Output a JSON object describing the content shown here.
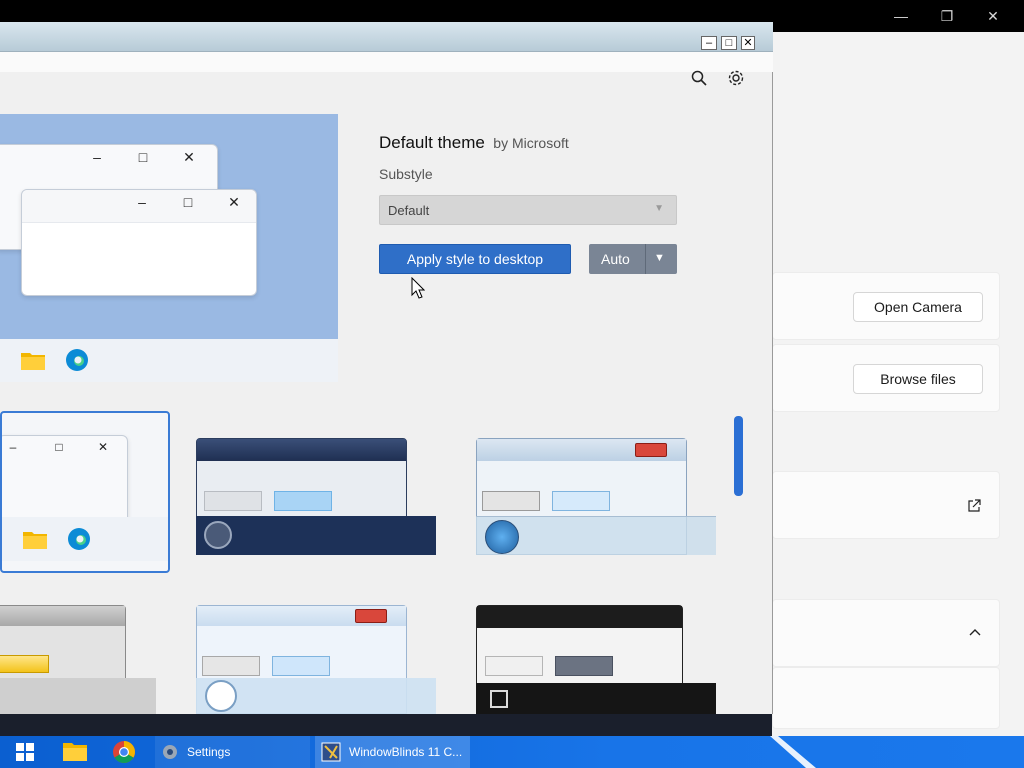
{
  "settings": {
    "open_camera": "Open Camera",
    "browse_files": "Browse files"
  },
  "theme": {
    "name": "Default theme",
    "author": "by Microsoft",
    "substyle_label": "Substyle",
    "substyle_value": "Default",
    "apply_label": "Apply style to desktop",
    "auto_label": "Auto"
  },
  "taskbar": {
    "settings_label": "Settings",
    "windowblinds_label": "WindowBlinds 11 C..."
  },
  "colors": {
    "accent": "#2f6fc8",
    "taskbar": "#1874e8"
  }
}
